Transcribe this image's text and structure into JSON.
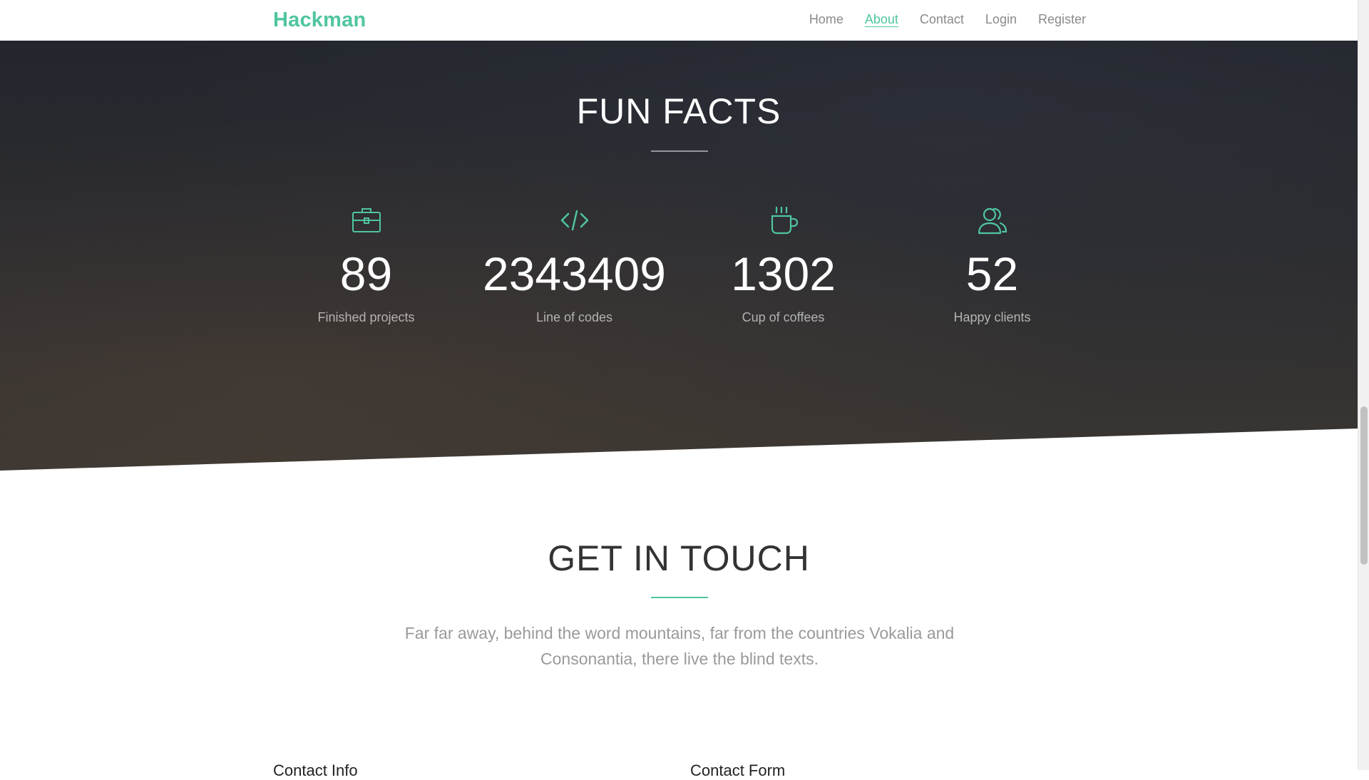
{
  "navbar": {
    "brand": "Hackman",
    "links": [
      {
        "label": "Home",
        "active": false
      },
      {
        "label": "About",
        "active": true
      },
      {
        "label": "Contact",
        "active": false
      },
      {
        "label": "Login",
        "active": false
      },
      {
        "label": "Register",
        "active": false
      }
    ]
  },
  "fun_facts": {
    "title": "FUN FACTS",
    "items": [
      {
        "icon": "briefcase-icon",
        "number": "89",
        "label": "Finished projects"
      },
      {
        "icon": "code-icon",
        "number": "2343409",
        "label": "Line of codes"
      },
      {
        "icon": "coffee-cup-icon",
        "number": "1302",
        "label": "Cup of coffees"
      },
      {
        "icon": "users-icon",
        "number": "52",
        "label": "Happy clients"
      }
    ]
  },
  "get_in_touch": {
    "title": "GET IN TOUCH",
    "text": "Far far away, behind the word mountains, far from the countries Vokalia and Consonantia, there live the blind texts.",
    "columns": [
      "Contact Info",
      "Contact Form"
    ]
  },
  "colors": {
    "accent": "#4fc5a0",
    "dark_bg": "#26282d"
  }
}
